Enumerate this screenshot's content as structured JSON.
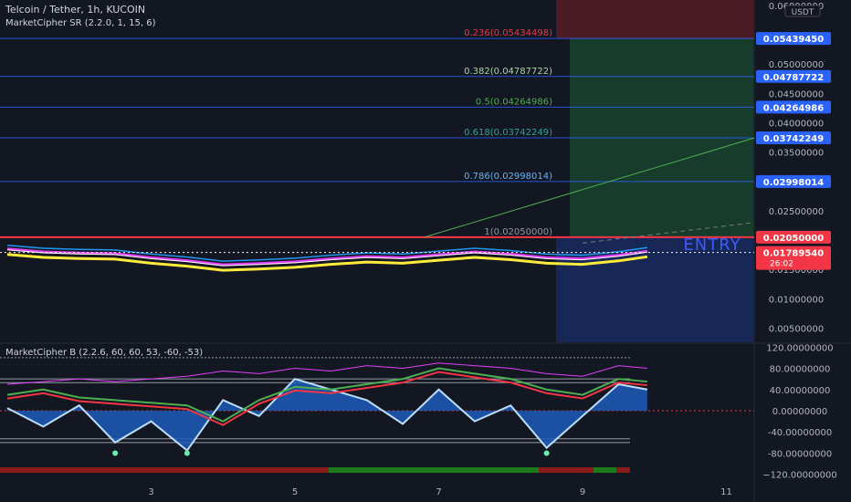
{
  "header": {
    "symbol": "Telcoin / Tether, 1h, KUCOIN",
    "indicator_sr": "MarketCipher SR (2.2.0, 1, 15, 6)",
    "indicator_b": "MarketCipher B (2.2.6, 60, 60, 53, -60, -53)"
  },
  "colors": {
    "background": "#131722",
    "fib_line": "#2962ff",
    "red_line": "#f23645",
    "green_zone": "#1e6b3a",
    "red_zone": "#7a1f2a",
    "blue_zone": "#1e3a8a",
    "axis_label_blue": "#2962ff",
    "axis_label_red": "#f23645"
  },
  "chart_data": [
    {
      "type": "line",
      "name": "price",
      "y_axis_currency": "USDT",
      "ylim": [
        0.0026,
        0.0609
      ],
      "y_ticks": [
        "0.06000000",
        "0.05000000",
        "0.04500000",
        "0.04000000",
        "0.03500000",
        "0.02500000",
        "0.01500000",
        "0.01000000",
        "0.00500000"
      ],
      "y_tick_values": [
        0.06,
        0.05,
        0.045,
        0.04,
        0.035,
        0.025,
        0.015,
        0.01,
        0.005
      ],
      "x_ticks": [
        {
          "label": "3",
          "day": 3
        },
        {
          "label": "5",
          "day": 5
        },
        {
          "label": "7",
          "day": 7
        },
        {
          "label": "9",
          "day": 9
        },
        {
          "label": "11",
          "day": 11
        }
      ],
      "fib_levels": [
        {
          "ratio": "0.236",
          "label": "0.236(0.05434498)",
          "value": 0.05434498,
          "axis_label": "0.05439450",
          "color": "#f23645"
        },
        {
          "ratio": "0.382",
          "label": "0.382(0.04787722)",
          "value": 0.04787722,
          "axis_label": "0.04787722",
          "color": "#a5d6a7"
        },
        {
          "ratio": "0.5",
          "label": "0.5(0.04264986)",
          "value": 0.04264986,
          "axis_label": "0.04264986",
          "color": "#4caf50"
        },
        {
          "ratio": "0.618",
          "label": "0.618(0.03742249)",
          "value": 0.03742249,
          "axis_label": "0.03742249",
          "color": "#26a69a"
        },
        {
          "ratio": "0.786",
          "label": "0.786(0.02998014)",
          "value": 0.02998014,
          "axis_label": "0.02998014",
          "color": "#64b5f6"
        },
        {
          "ratio": "1",
          "label": "1(0.02050000)",
          "value": 0.0205,
          "axis_label": "0.02050000",
          "color": "#9598a1"
        }
      ],
      "entry": {
        "label": "ENTRY",
        "value": 0.0205,
        "axis_label": "0.02050000"
      },
      "current_price": {
        "value": 0.0178954,
        "axis_label": "0.01789540",
        "countdown": "26:02"
      },
      "series": [
        {
          "day": [
            1.0,
            1.5,
            2.0,
            2.5,
            3.0,
            3.5,
            4.0,
            4.5,
            5.0,
            5.5,
            6.0,
            6.5,
            7.0,
            7.5,
            8.0,
            8.5,
            9.0,
            9.5,
            9.9
          ],
          "values": [
            0.0185,
            0.018,
            0.0178,
            0.0177,
            0.017,
            0.0165,
            0.0158,
            0.016,
            0.0163,
            0.0168,
            0.0172,
            0.017,
            0.0175,
            0.018,
            0.0176,
            0.017,
            0.0168,
            0.0174,
            0.0181
          ]
        }
      ]
    },
    {
      "type": "line",
      "name": "oscillator",
      "ylim": [
        -124,
        124
      ],
      "y_ticks": [
        "120.00000000",
        "80.00000000",
        "40.00000000",
        "0.00000000",
        "-40.00000000",
        "-80.00000000",
        "−120.00000000"
      ],
      "y_tick_values": [
        120,
        80,
        40,
        0,
        -40,
        -80,
        -120
      ],
      "levels": [
        100,
        60,
        53,
        -53,
        -60
      ],
      "series": [
        {
          "name": "wave",
          "day": [
            1.0,
            1.5,
            2.0,
            2.5,
            3.0,
            3.5,
            4.0,
            4.5,
            5.0,
            5.5,
            6.0,
            6.5,
            7.0,
            7.5,
            8.0,
            8.5,
            9.0,
            9.5,
            9.9
          ],
          "values": [
            5,
            -30,
            10,
            -60,
            -20,
            -75,
            20,
            -10,
            60,
            40,
            20,
            -25,
            40,
            -20,
            10,
            -70,
            -10,
            50,
            40
          ]
        },
        {
          "name": "money_flow",
          "day": [
            1.0,
            1.5,
            2.0,
            2.5,
            3.0,
            3.5,
            4.0,
            4.5,
            5.0,
            5.5,
            6.0,
            6.5,
            7.0,
            7.5,
            8.0,
            8.5,
            9.0,
            9.5,
            9.9
          ],
          "values": [
            30,
            40,
            25,
            20,
            15,
            10,
            -20,
            20,
            45,
            40,
            50,
            60,
            80,
            70,
            60,
            40,
            30,
            60,
            55
          ]
        },
        {
          "name": "rsi",
          "day": [
            1.0,
            1.5,
            2.0,
            2.5,
            3.0,
            3.5,
            4.0,
            4.5,
            5.0,
            5.5,
            6.0,
            6.5,
            7.0,
            7.5,
            8.0,
            8.5,
            9.0,
            9.5,
            9.9
          ],
          "values": [
            50,
            55,
            60,
            55,
            60,
            65,
            75,
            70,
            80,
            75,
            85,
            80,
            90,
            85,
            80,
            70,
            65,
            85,
            80
          ]
        }
      ]
    }
  ]
}
